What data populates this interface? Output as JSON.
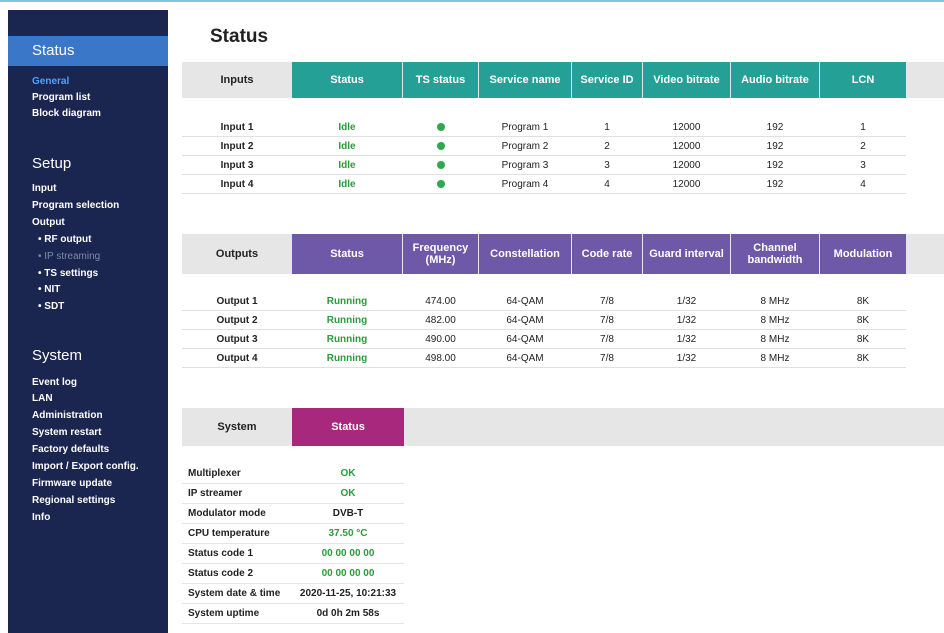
{
  "sidebar": {
    "sections": [
      {
        "title": "Status",
        "items": [
          "General",
          "Program list",
          "Block diagram"
        ]
      },
      {
        "title": "Setup",
        "items": [
          "Input",
          "Program selection",
          "Output",
          "• RF output",
          "• IP streaming",
          "• TS settings",
          "• NIT",
          "• SDT"
        ]
      },
      {
        "title": "System",
        "items": [
          "Event log",
          "LAN",
          "Administration",
          "System restart",
          "Factory defaults",
          "Import / Export config.",
          "Firmware update",
          "Regional settings",
          "Info"
        ]
      }
    ]
  },
  "page_title": "Status",
  "inputs": {
    "headers": [
      "Inputs",
      "Status",
      "TS status",
      "Service name",
      "Service ID",
      "Video bitrate",
      "Audio bitrate",
      "LCN"
    ],
    "rows": [
      [
        "Input 1",
        "Idle",
        "",
        "Program 1",
        "1",
        "12000",
        "192",
        "1"
      ],
      [
        "Input 2",
        "Idle",
        "",
        "Program 2",
        "2",
        "12000",
        "192",
        "2"
      ],
      [
        "Input 3",
        "Idle",
        "",
        "Program 3",
        "3",
        "12000",
        "192",
        "3"
      ],
      [
        "Input 4",
        "Idle",
        "",
        "Program 4",
        "4",
        "12000",
        "192",
        "4"
      ]
    ]
  },
  "outputs": {
    "headers": [
      "Outputs",
      "Status",
      "Frequency (MHz)",
      "Constellation",
      "Code rate",
      "Guard interval",
      "Channel bandwidth",
      "Modulation"
    ],
    "rows": [
      [
        "Output 1",
        "Running",
        "474.00",
        "64-QAM",
        "7/8",
        "1/32",
        "8 MHz",
        "8K"
      ],
      [
        "Output 2",
        "Running",
        "482.00",
        "64-QAM",
        "7/8",
        "1/32",
        "8 MHz",
        "8K"
      ],
      [
        "Output 3",
        "Running",
        "490.00",
        "64-QAM",
        "7/8",
        "1/32",
        "8 MHz",
        "8K"
      ],
      [
        "Output 4",
        "Running",
        "498.00",
        "64-QAM",
        "7/8",
        "1/32",
        "8 MHz",
        "8K"
      ]
    ]
  },
  "system": {
    "headers": [
      "System",
      "Status"
    ],
    "rows": [
      [
        "Multiplexer",
        "OK"
      ],
      [
        "IP streamer",
        "OK"
      ],
      [
        "Modulator mode",
        "DVB-T"
      ],
      [
        "CPU temperature",
        "37.50 °C"
      ],
      [
        "Status code 1",
        "00 00 00 00"
      ],
      [
        "Status code 2",
        "00 00 00 00"
      ],
      [
        "System date & time",
        "2020-11-25, 10:21:33"
      ],
      [
        "System uptime",
        "0d 0h 2m 58s"
      ]
    ]
  },
  "colors": {
    "inputs_header": "#24a096",
    "outputs_header": "#6e58a8",
    "system_header": "#a8287e",
    "sidebar": "#1a2550",
    "ok_green": "#2c9a3a"
  }
}
